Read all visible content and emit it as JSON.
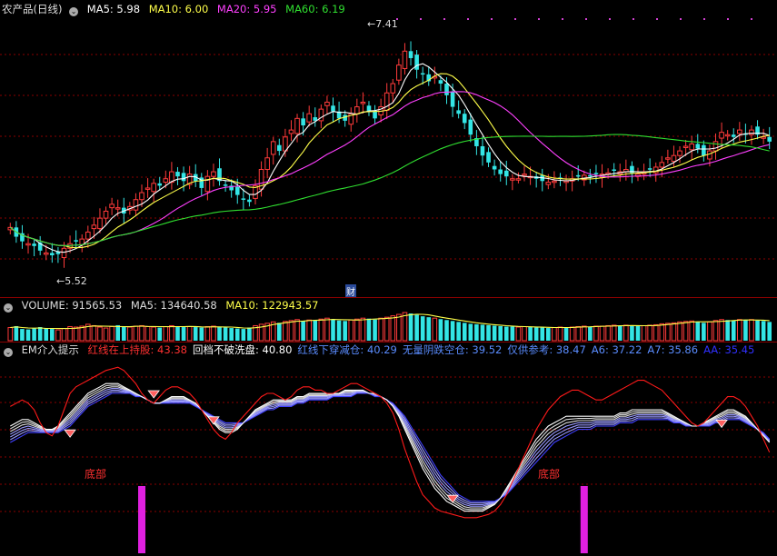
{
  "colors": {
    "up": "#ff3b3b",
    "down": "#33e5e5",
    "ma5": "#ffffff",
    "ma10": "#ffff4a",
    "ma20": "#ff40ff",
    "ma60": "#30e030",
    "grid": "#8a0000",
    "red_line": "#ff1a1a",
    "white_line": "#ffffff",
    "blue_line": "#4040ff",
    "signal": "#e020e0"
  },
  "header": {
    "title": "农产品(日线)",
    "ma5": "MA5: 5.98",
    "ma10": "MA10: 6.00",
    "ma20": "MA20: 5.95",
    "ma60": "MA60: 6.19"
  },
  "annotations": {
    "high_label": "7.41",
    "low_label": "5.52",
    "cai_label": "财",
    "bottom_label": "底部"
  },
  "volume_header": {
    "volume": "VOLUME: 91565.53",
    "ma5": "MA5: 134640.58",
    "ma10": "MA10: 122943.57"
  },
  "indicator_header": {
    "name": "EM介入提示",
    "items": [
      {
        "text": "红线在上持股: 43.38",
        "color": "#ff3030"
      },
      {
        "text": "回档不破洗盘: 40.80",
        "color": "#ffffff"
      },
      {
        "text": "红线下穿减仓: 40.29",
        "color": "#5a8cff"
      },
      {
        "text": "无量阴跌空仓: 39.52",
        "color": "#5a8cff"
      },
      {
        "text": "仅供参考: 38.47",
        "color": "#5a8cff"
      },
      {
        "text": "A6: 37.22",
        "color": "#5a8cff"
      },
      {
        "text": "A7: 35.86",
        "color": "#5a8cff"
      },
      {
        "text": "AA: 35.45",
        "color": "#3030ff"
      }
    ]
  },
  "chart_data": [
    {
      "type": "candlestick",
      "key_points": [
        {
          "label": "high",
          "value": 7.41
        },
        {
          "label": "low",
          "value": 5.52
        }
      ],
      "close": [
        5.78,
        5.7,
        5.66,
        5.64,
        5.62,
        5.58,
        5.56,
        5.54,
        5.55,
        5.6,
        5.64,
        5.66,
        5.68,
        5.74,
        5.8,
        5.86,
        5.92,
        5.98,
        5.95,
        5.9,
        5.96,
        6.02,
        6.08,
        6.12,
        6.16,
        6.14,
        6.2,
        6.26,
        6.22,
        6.18,
        6.24,
        6.18,
        6.12,
        6.22,
        6.26,
        6.18,
        6.14,
        6.1,
        6.06,
        6.02,
        6.0,
        6.14,
        6.28,
        6.38,
        6.52,
        6.44,
        6.56,
        6.62,
        6.72,
        6.66,
        6.76,
        6.7,
        6.8,
        6.86,
        6.78,
        6.72,
        6.7,
        6.76,
        6.82,
        6.86,
        6.78,
        6.72,
        6.82,
        6.94,
        7.02,
        7.18,
        7.3,
        7.24,
        7.14,
        7.1,
        7.04,
        7.08,
        7.02,
        6.92,
        6.82,
        6.76,
        6.68,
        6.58,
        6.48,
        6.4,
        6.34,
        6.28,
        6.24,
        6.22,
        6.2,
        6.2,
        6.24,
        6.22,
        6.2,
        6.18,
        6.17,
        6.18,
        6.2,
        6.18,
        6.2,
        6.22,
        6.23,
        6.22,
        6.24,
        6.24,
        6.25,
        6.27,
        6.26,
        6.28,
        6.25,
        6.24,
        6.26,
        6.28,
        6.3,
        6.34,
        6.38,
        6.4,
        6.44,
        6.48,
        6.5,
        6.46,
        6.4,
        6.44,
        6.52,
        6.6,
        6.58,
        6.56,
        6.62,
        6.58,
        6.62,
        6.58,
        6.56,
        6.52
      ],
      "axis": {
        "ylim": [
          5.25,
          7.6
        ]
      },
      "series_names": [
        "MA5",
        "MA10",
        "MA20",
        "MA60"
      ]
    },
    {
      "type": "bar",
      "name": "VOLUME",
      "values": [
        56,
        62,
        50,
        48,
        52,
        58,
        54,
        50,
        46,
        52,
        60,
        58,
        62,
        70,
        64,
        58,
        54,
        60,
        66,
        60,
        58,
        62,
        64,
        60,
        58,
        56,
        60,
        64,
        62,
        58,
        60,
        58,
        56,
        60,
        62,
        58,
        56,
        54,
        52,
        50,
        56,
        64,
        70,
        74,
        80,
        76,
        82,
        86,
        90,
        84,
        88,
        86,
        92,
        96,
        90,
        86,
        84,
        88,
        92,
        96,
        94,
        90,
        96,
        100,
        106,
        112,
        120,
        116,
        110,
        104,
        100,
        96,
        92,
        88,
        84,
        80,
        76,
        72,
        70,
        68,
        66,
        64,
        62,
        60,
        60,
        58,
        60,
        58,
        56,
        56,
        54,
        56,
        58,
        56,
        58,
        60,
        62,
        60,
        62,
        62,
        64,
        66,
        64,
        66,
        64,
        62,
        64,
        66,
        68,
        72,
        74,
        76,
        80,
        82,
        84,
        80,
        76,
        80,
        86,
        90,
        88,
        86,
        90,
        88,
        90,
        86,
        84,
        80
      ],
      "ma5": 134640.58,
      "ma10": 122943.57,
      "last": 91565.53
    },
    {
      "type": "line",
      "name": "EM介入提示",
      "ylim": [
        0,
        100
      ],
      "series": [
        {
          "name": "红线在上持股",
          "values": [
            72,
            74,
            76,
            74,
            70,
            62,
            56,
            54,
            60,
            70,
            80,
            84,
            86,
            88,
            90,
            92,
            94,
            95,
            96,
            94,
            90,
            86,
            80,
            76,
            74,
            78,
            82,
            84,
            84,
            82,
            80,
            76,
            70,
            64,
            58,
            54,
            52,
            56,
            62,
            66,
            70,
            74,
            78,
            80,
            80,
            78,
            76,
            78,
            82,
            84,
            84,
            82,
            82,
            80,
            80,
            82,
            84,
            86,
            86,
            84,
            82,
            80,
            78,
            74,
            68,
            58,
            46,
            36,
            26,
            18,
            14,
            10,
            8,
            7,
            6,
            5,
            4,
            4,
            4,
            5,
            6,
            8,
            12,
            18,
            26,
            34,
            42,
            50,
            58,
            64,
            70,
            74,
            78,
            80,
            82,
            82,
            80,
            78,
            76,
            76,
            78,
            80,
            82,
            84,
            86,
            88,
            88,
            86,
            84,
            82,
            78,
            74,
            70,
            66,
            62,
            60,
            62,
            66,
            70,
            74,
            78,
            78,
            76,
            72,
            66,
            60,
            52,
            44
          ]
        },
        {
          "name": "回档不破洗盘",
          "values": [
            60,
            62,
            64,
            64,
            62,
            60,
            58,
            58,
            60,
            64,
            68,
            72,
            76,
            80,
            82,
            84,
            86,
            86,
            86,
            84,
            82,
            80,
            78,
            76,
            74,
            74,
            76,
            78,
            78,
            78,
            76,
            74,
            70,
            66,
            62,
            58,
            56,
            56,
            58,
            62,
            66,
            70,
            72,
            74,
            76,
            76,
            76,
            76,
            78,
            78,
            80,
            80,
            80,
            80,
            80,
            80,
            82,
            82,
            82,
            82,
            80,
            80,
            78,
            76,
            72,
            66,
            58,
            50,
            42,
            34,
            28,
            22,
            18,
            14,
            12,
            10,
            8,
            8,
            8,
            8,
            10,
            12,
            16,
            22,
            28,
            34,
            40,
            46,
            52,
            56,
            60,
            62,
            64,
            66,
            66,
            66,
            66,
            66,
            66,
            66,
            66,
            66,
            68,
            68,
            70,
            70,
            70,
            70,
            70,
            70,
            68,
            66,
            64,
            62,
            60,
            60,
            62,
            64,
            66,
            68,
            70,
            70,
            68,
            66,
            62,
            58,
            54,
            50
          ]
        },
        {
          "name": "AA",
          "values": [
            50,
            52,
            54,
            56,
            56,
            56,
            56,
            56,
            56,
            58,
            60,
            64,
            68,
            72,
            74,
            76,
            78,
            80,
            80,
            80,
            80,
            78,
            78,
            76,
            74,
            74,
            74,
            74,
            74,
            74,
            74,
            72,
            70,
            68,
            66,
            64,
            62,
            62,
            62,
            62,
            64,
            66,
            68,
            70,
            70,
            72,
            72,
            72,
            74,
            74,
            76,
            76,
            76,
            76,
            78,
            78,
            78,
            78,
            80,
            80,
            80,
            78,
            78,
            76,
            74,
            70,
            66,
            60,
            54,
            48,
            42,
            36,
            30,
            26,
            22,
            18,
            16,
            14,
            14,
            14,
            14,
            14,
            16,
            18,
            22,
            26,
            30,
            34,
            38,
            42,
            46,
            50,
            52,
            54,
            56,
            58,
            58,
            58,
            60,
            60,
            60,
            60,
            62,
            62,
            62,
            64,
            64,
            64,
            64,
            64,
            64,
            62,
            62,
            60,
            60,
            60,
            60,
            60,
            62,
            62,
            64,
            64,
            64,
            62,
            60,
            58,
            56,
            52
          ]
        }
      ],
      "signal_bars": [
        {
          "index": 22,
          "value": 40
        },
        {
          "index": 96,
          "value": 40
        }
      ]
    }
  ]
}
